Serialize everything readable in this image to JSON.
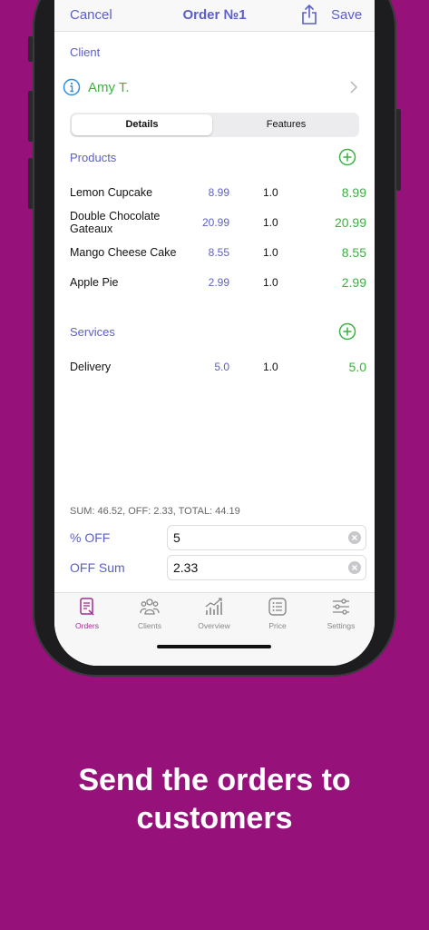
{
  "navbar": {
    "cancel_label": "Cancel",
    "title": "Order №1",
    "save_label": "Save"
  },
  "client": {
    "section_label": "Client",
    "name": "Amy T."
  },
  "segments": [
    {
      "label": "Details",
      "selected": true
    },
    {
      "label": "Features",
      "selected": false
    }
  ],
  "products": {
    "section_label": "Products",
    "items": [
      {
        "name": "Lemon Cupcake",
        "price": "8.99",
        "qty": "1.0",
        "total": "8.99"
      },
      {
        "name": "Double Chocolate Gateaux",
        "price": "20.99",
        "qty": "1.0",
        "total": "20.99"
      },
      {
        "name": "Mango Cheese Cake",
        "price": "8.55",
        "qty": "1.0",
        "total": "8.55"
      },
      {
        "name": "Apple Pie",
        "price": "2.99",
        "qty": "1.0",
        "total": "2.99"
      }
    ]
  },
  "services": {
    "section_label": "Services",
    "items": [
      {
        "name": "Delivery",
        "price": "5.0",
        "qty": "1.0",
        "total": "5.0"
      }
    ]
  },
  "summary": "SUM: 46.52, OFF: 2.33, TOTAL: 44.19",
  "discount": {
    "percent_label": "% OFF",
    "percent_value": "5",
    "sum_label": "OFF Sum",
    "sum_value": "2.33"
  },
  "tabs": [
    {
      "label": "Orders",
      "icon": "orders-icon",
      "active": true
    },
    {
      "label": "Clients",
      "icon": "clients-icon",
      "active": false
    },
    {
      "label": "Overview",
      "icon": "overview-icon",
      "active": false
    },
    {
      "label": "Price",
      "icon": "price-icon",
      "active": false
    },
    {
      "label": "Settings",
      "icon": "settings-icon",
      "active": false
    }
  ],
  "caption": {
    "line1": "Send the orders to",
    "line2": "customers"
  },
  "colors": {
    "background": "#97117a",
    "accent": "#5b5fc7",
    "positive": "#3cb043",
    "active_tab": "#a12d94"
  }
}
